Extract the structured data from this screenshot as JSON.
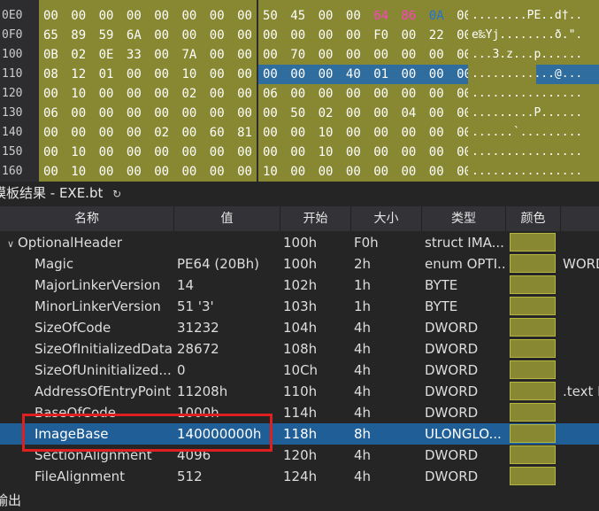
{
  "hex": {
    "rows": [
      {
        "addr": "0E0",
        "bytes_a": [
          "00",
          "00",
          "00",
          "00",
          "00",
          "00",
          "00",
          "00"
        ],
        "bytes_b": [
          "50",
          "45",
          "00",
          "00",
          "64",
          "86",
          "0A",
          "00"
        ],
        "ascii": "........PE..d†.."
      },
      {
        "addr": "0F0",
        "bytes_a": [
          "65",
          "89",
          "59",
          "6A",
          "00",
          "00",
          "00",
          "00"
        ],
        "bytes_b": [
          "00",
          "00",
          "00",
          "00",
          "F0",
          "00",
          "22",
          "00"
        ],
        "ascii": "e‰Yj........ð.\"."
      },
      {
        "addr": "100",
        "bytes_a": [
          "0B",
          "02",
          "0E",
          "33",
          "00",
          "7A",
          "00",
          "00"
        ],
        "bytes_b": [
          "00",
          "70",
          "00",
          "00",
          "00",
          "00",
          "00",
          "00"
        ],
        "ascii": "...3.z...p......"
      },
      {
        "addr": "110",
        "bytes_a": [
          "08",
          "12",
          "01",
          "00",
          "00",
          "10",
          "00",
          "00"
        ],
        "bytes_b": [
          "00",
          "00",
          "00",
          "40",
          "01",
          "00",
          "00",
          "00"
        ],
        "ascii": "............@..."
      },
      {
        "addr": "120",
        "bytes_a": [
          "00",
          "10",
          "00",
          "00",
          "00",
          "02",
          "00",
          "00"
        ],
        "bytes_b": [
          "06",
          "00",
          "00",
          "00",
          "00",
          "00",
          "00",
          "00"
        ],
        "ascii": "................"
      },
      {
        "addr": "130",
        "bytes_a": [
          "06",
          "00",
          "00",
          "00",
          "00",
          "00",
          "00",
          "00"
        ],
        "bytes_b": [
          "00",
          "50",
          "02",
          "00",
          "00",
          "04",
          "00",
          "00"
        ],
        "ascii": ".........P......"
      },
      {
        "addr": "140",
        "bytes_a": [
          "00",
          "00",
          "00",
          "00",
          "02",
          "00",
          "60",
          "81"
        ],
        "bytes_b": [
          "00",
          "00",
          "10",
          "00",
          "00",
          "00",
          "00",
          "00"
        ],
        "ascii": "......`........."
      },
      {
        "addr": "150",
        "bytes_a": [
          "00",
          "10",
          "00",
          "00",
          "00",
          "00",
          "00",
          "00"
        ],
        "bytes_b": [
          "00",
          "00",
          "10",
          "00",
          "00",
          "00",
          "00",
          "00"
        ],
        "ascii": "................"
      },
      {
        "addr": "160",
        "bytes_a": [
          "00",
          "10",
          "00",
          "00",
          "00",
          "00",
          "00",
          "00"
        ],
        "bytes_b": [
          "10",
          "00",
          "00",
          "00",
          "00",
          "00",
          "00",
          "00"
        ],
        "ascii": "................"
      }
    ]
  },
  "template": {
    "title": "模板结果 - EXE.bt",
    "refresh_icon": "↻"
  },
  "table": {
    "headers": [
      "名称",
      "值",
      "开始",
      "大小",
      "类型",
      "颜色"
    ],
    "rows": [
      {
        "name": "OptionalHeader",
        "value": "",
        "start": "100h",
        "size": "F0h",
        "type": "struct IMA...",
        "extra": ""
      },
      {
        "name": "Magic",
        "value": "PE64 (20Bh)",
        "start": "100h",
        "size": "2h",
        "type": "enum OPTI...",
        "extra": "WORD"
      },
      {
        "name": "MajorLinkerVersion",
        "value": "14",
        "start": "102h",
        "size": "1h",
        "type": "BYTE",
        "extra": ""
      },
      {
        "name": "MinorLinkerVersion",
        "value": "51 '3'",
        "start": "103h",
        "size": "1h",
        "type": "BYTE",
        "extra": ""
      },
      {
        "name": "SizeOfCode",
        "value": "31232",
        "start": "104h",
        "size": "4h",
        "type": "DWORD",
        "extra": ""
      },
      {
        "name": "SizeOfInitializedData",
        "value": "28672",
        "start": "108h",
        "size": "4h",
        "type": "DWORD",
        "extra": ""
      },
      {
        "name": "SizeOfUninitialized...",
        "value": "0",
        "start": "10Ch",
        "size": "4h",
        "type": "DWORD",
        "extra": ""
      },
      {
        "name": "AddressOfEntryPoint",
        "value": "11208h",
        "start": "110h",
        "size": "4h",
        "type": "DWORD",
        "extra": ".text F"
      },
      {
        "name": "BaseOfCode",
        "value": "1000h",
        "start": "114h",
        "size": "4h",
        "type": "DWORD",
        "extra": ""
      },
      {
        "name": "ImageBase",
        "value": "140000000h",
        "start": "118h",
        "size": "8h",
        "type": "ULONGLO...",
        "extra": ""
      },
      {
        "name": "SectionAlignment",
        "value": "4096",
        "start": "120h",
        "size": "4h",
        "type": "DWORD",
        "extra": ""
      },
      {
        "name": "FileAlignment",
        "value": "512",
        "start": "124h",
        "size": "4h",
        "type": "DWORD",
        "extra": ""
      }
    ]
  },
  "output": {
    "title": "输出"
  },
  "colors": {
    "hex_bg": "#888833",
    "selection": "#1f5e96",
    "highlight": "#e02020"
  }
}
